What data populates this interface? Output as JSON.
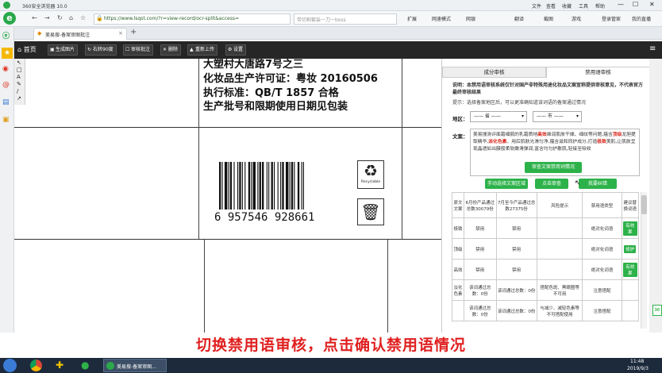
{
  "browser": {
    "title": "360安全浏览器 10.0",
    "title_menu": [
      "文件",
      "查看",
      "收藏",
      "工具",
      "帮助"
    ],
    "url": "https://www.lsqst.com/?r=view-record/ocr-split&access=",
    "search_placeholder": "带切割套装一刀一boss",
    "bar_items": [
      "扩展",
      "网速模式",
      "网银",
      "翻译",
      "截图",
      "游戏",
      "登录管家",
      "我的直播"
    ],
    "tab_label": "美易搜-备案审图批注",
    "newtab": "+"
  },
  "app": {
    "toolbar": {
      "home": "首页",
      "gen_image": "生成图片",
      "rotate": "右转90度",
      "review_note": "审核批注",
      "delete": "删除",
      "reupload": "重新上传",
      "settings": "设置"
    }
  },
  "doc": {
    "lines": [
      "大塑村大唐路7号之三",
      "化妆品生产许可证：粤妆 20160506",
      "执行标准：QB/T 1857    合格",
      "生产批号和限期使用日期见包装"
    ],
    "barcode": "6 957546 928661",
    "recycle_label": "Recyclable"
  },
  "panel": {
    "tab_component": "成分审核",
    "tab_banned": "禁用语审核",
    "notice": "说明：本禁用语审核系统仅针对国产非特殊用途化妆品文案宣称提供审核意见，不代表官方最终审核结果",
    "hint": "提示：选择备案地区后，可以更准确知道该词语的备案通过情况",
    "region_label": "地区：",
    "province_select": "—— 省 ——",
    "city_select": "—— 市 ——",
    "copy_label": "文案：",
    "copy_text": "美易搜测评面霜细腻的乳霜质地高效维润肌肤干燥、细纹等问题,蕴含顶级龙胆提取精华,淡化色素、用后肌肤光滑匀净,蕴含滋和同护成分,打造极致美肌,让肌肤呈现晶透如出膜般柔软嫩滑弹润,富含均匀护散肌,轻接至吸收",
    "copy_highlights": [
      "高效",
      "顶级",
      "淡化色素",
      "极致"
    ],
    "confirm_button": "审查文案禁用词情况",
    "btn_manual": "手动选择文案区域",
    "btn_audit": "点击审查",
    "btn_find": "我要纠错",
    "table": {
      "headers": [
        "原文文案",
        "6月份产品通过总数30079份",
        "7月至今产品通过总数27375份",
        "风险提示",
        "禁用语类型",
        "建议替换词语"
      ],
      "rows": [
        {
          "word": "极致",
          "jun": "禁用",
          "jul": "禁用",
          "risk": "",
          "type": "绝对化词语",
          "suggest": "有效果"
        },
        {
          "word": "顶级",
          "jun": "禁用",
          "jul": "禁用",
          "risk": "",
          "type": "绝对化词语",
          "suggest": "修护"
        },
        {
          "word": "高效",
          "jun": "禁用",
          "jul": "禁用",
          "risk": "",
          "type": "绝对化词语",
          "suggest": "有效果"
        },
        {
          "word": "淡化色素",
          "jun": "该词通过总数：0份",
          "jul": "该词通过总数：0份",
          "risk": "搭配色斑、黑眼圈等不可用",
          "type": "注意搭配",
          "suggest": ""
        },
        {
          "word": "",
          "jun": "该词通过总数：0份",
          "jul": "该词通过总数：0份",
          "risk": "与减少、减轻色素等不可搭配使用",
          "type": "注意搭配",
          "suggest": ""
        }
      ]
    }
  },
  "caption": "切换禁用语审核，点击确认禁用语情况",
  "taskbar": {
    "window_label": "美易搜-备案审图...",
    "time": "11:48",
    "date": "2019/9/3"
  },
  "colors": {
    "accent_green": "#2db24a",
    "toolbar_dark": "#262626",
    "caption_red": "#e02020",
    "highlight_red": "#d9261c"
  }
}
